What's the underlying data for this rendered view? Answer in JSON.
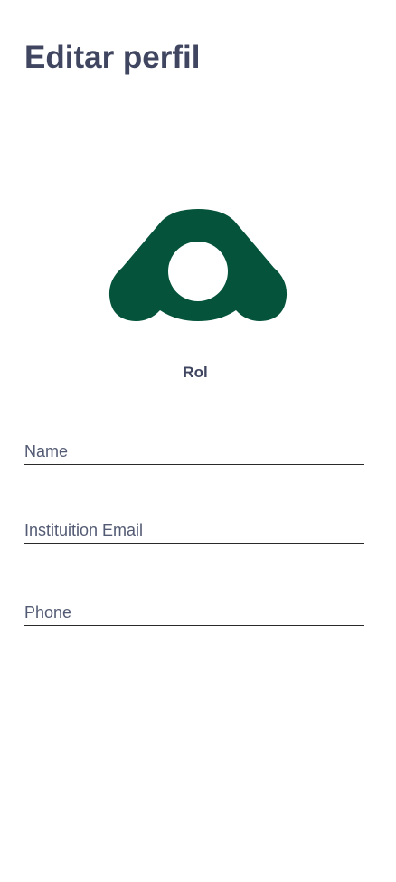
{
  "header": {
    "title": "Editar perfil"
  },
  "profile": {
    "logo_icon": "brand-logo-icon",
    "logo_color": "#04533A",
    "role_label": "Rol"
  },
  "form": {
    "name": {
      "placeholder": "Name",
      "value": ""
    },
    "email": {
      "placeholder": "Instituition Email",
      "value": ""
    },
    "phone": {
      "placeholder": "Phone",
      "value": ""
    }
  },
  "colors": {
    "text": "#404660",
    "underline": "#2A2A2A",
    "background": "#FFFFFF"
  }
}
